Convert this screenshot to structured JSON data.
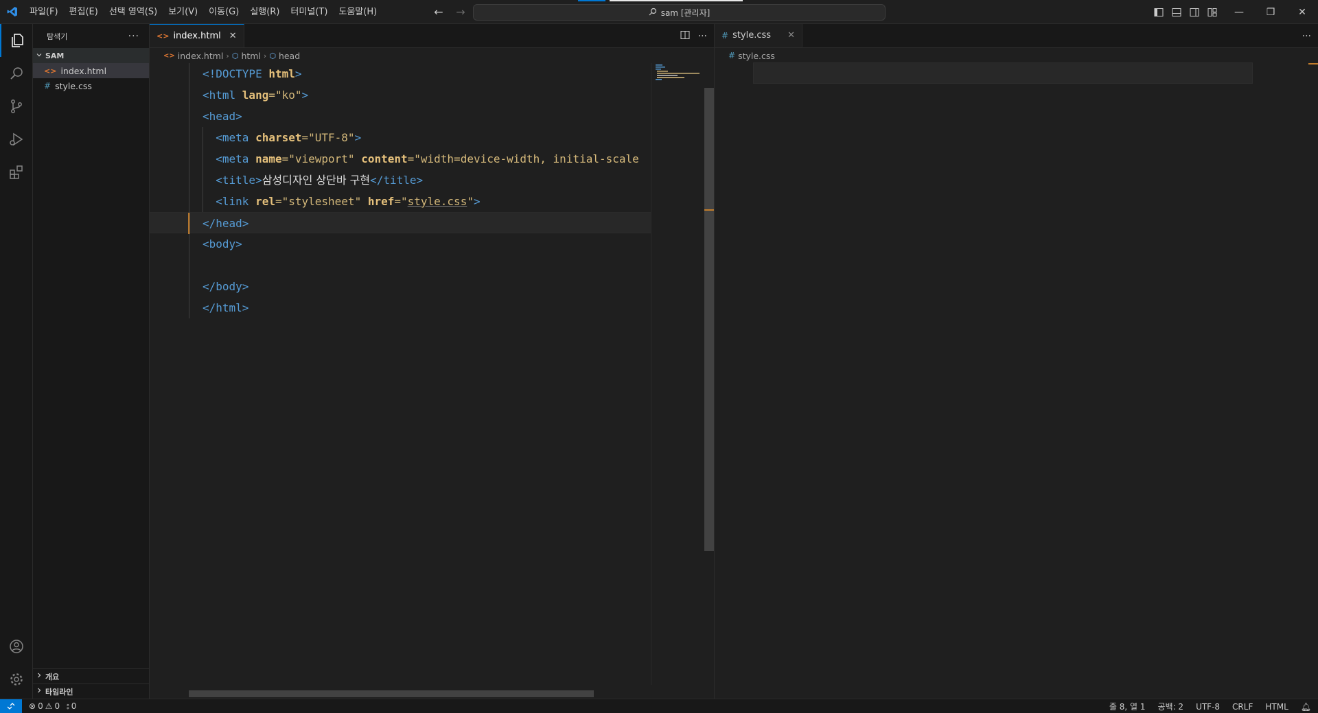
{
  "menu": [
    "파일(F)",
    "편집(E)",
    "선택 영역(S)",
    "보기(V)",
    "이동(G)",
    "실행(R)",
    "터미널(T)",
    "도움말(H)"
  ],
  "search": {
    "label": "sam [관리자]"
  },
  "colors": {
    "accent": "#0078d4",
    "modified": "#c27d2c",
    "tag": "#569cd6",
    "attr": "#e5c07b",
    "string": "#d4b87a"
  },
  "sidebar": {
    "title": "탐색기",
    "folder": "SAM",
    "files": [
      {
        "name": "index.html",
        "icon": "html-file-icon"
      },
      {
        "name": "style.css",
        "icon": "css-file-icon"
      }
    ],
    "bottom": [
      "개요",
      "타임라인"
    ]
  },
  "editor1": {
    "tab": "index.html",
    "breadcrumb": [
      "index.html",
      "html",
      "head"
    ],
    "lines": [
      {
        "parts": [
          [
            "tag",
            "<!DOCTYPE "
          ],
          [
            "attrb",
            "html"
          ],
          [
            "tag",
            ">"
          ]
        ]
      },
      {
        "parts": [
          [
            "tag",
            "<html "
          ],
          [
            "attrb",
            "lang"
          ],
          [
            "str",
            "=\"ko\""
          ],
          [
            "tag",
            ">"
          ]
        ]
      },
      {
        "parts": [
          [
            "tag",
            "<head>"
          ]
        ]
      },
      {
        "parts": [
          [
            "sp",
            "  "
          ],
          [
            "tag",
            "<meta "
          ],
          [
            "attrb",
            "charset"
          ],
          [
            "str",
            "=\"UTF-8\""
          ],
          [
            "tag",
            ">"
          ]
        ]
      },
      {
        "parts": [
          [
            "sp",
            "  "
          ],
          [
            "tag",
            "<meta "
          ],
          [
            "attrb",
            "name"
          ],
          [
            "str",
            "=\"viewport\" "
          ],
          [
            "attrb",
            "content"
          ],
          [
            "str",
            "=\"width=device-width, initial-scale"
          ]
        ]
      },
      {
        "parts": [
          [
            "sp",
            "  "
          ],
          [
            "tag",
            "<title>"
          ],
          [
            "text",
            "삼성디자인 상단바 구현"
          ],
          [
            "tag",
            "</title>"
          ]
        ]
      },
      {
        "parts": [
          [
            "sp",
            "  "
          ],
          [
            "tag",
            "<link "
          ],
          [
            "attrb",
            "rel"
          ],
          [
            "str",
            "=\"stylesheet\" "
          ],
          [
            "attrb",
            "href"
          ],
          [
            "str",
            "=\""
          ],
          [
            "link",
            "style.css"
          ],
          [
            "str",
            "\""
          ],
          [
            "tag",
            ">"
          ]
        ]
      },
      {
        "parts": [
          [
            "tag",
            "</head>"
          ]
        ]
      },
      {
        "parts": [
          [
            "tag",
            "<body>"
          ]
        ]
      },
      {
        "parts": []
      },
      {
        "parts": [
          [
            "tag",
            "</body>"
          ]
        ]
      },
      {
        "parts": [
          [
            "tag",
            "</html>"
          ]
        ]
      }
    ]
  },
  "editor2": {
    "tab": "style.css",
    "breadcrumb": [
      "style.css"
    ]
  },
  "status": {
    "errors": "0",
    "warnings": "0",
    "ports": "0",
    "position": "줄 8, 열 1",
    "spaces": "공백: 2",
    "encoding": "UTF-8",
    "eol": "CRLF",
    "language": "HTML"
  }
}
